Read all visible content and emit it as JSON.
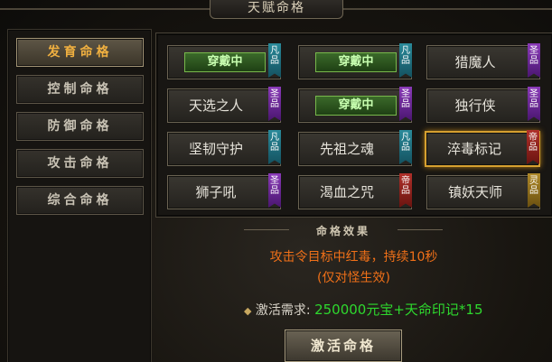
{
  "window": {
    "title": "天赋命格"
  },
  "sidebar": {
    "items": [
      {
        "label": "发育命格",
        "active": true
      },
      {
        "label": "控制命格",
        "active": false
      },
      {
        "label": "防御命格",
        "active": false
      },
      {
        "label": "攻击命格",
        "active": false
      },
      {
        "label": "综合命格",
        "active": false
      }
    ]
  },
  "grid": {
    "cards": [
      {
        "name": "",
        "equipped_label": "穿戴中",
        "equipped": true,
        "grade": "凡品",
        "selected": false
      },
      {
        "name": "",
        "equipped_label": "穿戴中",
        "equipped": true,
        "grade": "凡品",
        "selected": false
      },
      {
        "name": "猎魔人",
        "equipped_label": "",
        "equipped": false,
        "grade": "圣品",
        "selected": false
      },
      {
        "name": "天选之人",
        "equipped_label": "",
        "equipped": false,
        "grade": "圣品",
        "selected": false
      },
      {
        "name": "",
        "equipped_label": "穿戴中",
        "equipped": true,
        "grade": "圣品",
        "selected": false
      },
      {
        "name": "独行侠",
        "equipped_label": "",
        "equipped": false,
        "grade": "圣品",
        "selected": false
      },
      {
        "name": "坚韧守护",
        "equipped_label": "",
        "equipped": false,
        "grade": "凡品",
        "selected": false
      },
      {
        "name": "先祖之魂",
        "equipped_label": "",
        "equipped": false,
        "grade": "凡品",
        "selected": false
      },
      {
        "name": "淬毒标记",
        "equipped_label": "",
        "equipped": false,
        "grade": "帝品",
        "selected": true
      },
      {
        "name": "狮子吼",
        "equipped_label": "",
        "equipped": false,
        "grade": "圣品",
        "selected": false
      },
      {
        "name": "渴血之咒",
        "equipped_label": "",
        "equipped": false,
        "grade": "帝品",
        "selected": false
      },
      {
        "name": "镇妖天师",
        "equipped_label": "",
        "equipped": false,
        "grade": "灵品",
        "selected": false
      }
    ]
  },
  "effect": {
    "header": "命格效果",
    "line1": "攻击令目标中红毒，持续10秒",
    "line2": "(仅对怪生效)"
  },
  "requirement": {
    "label": "激活需求:",
    "value": "250000元宝+天命印记*15"
  },
  "actions": {
    "activate_label": "激活命格"
  },
  "colors": {
    "grade_fan": "#2a8a9a",
    "grade_sheng": "#8a3ab8",
    "grade_di": "#b0302a",
    "grade_ling": "#b08a2a",
    "effect_text": "#f07018",
    "requirement_value": "#2ed82e",
    "active_tab_text": "#f0b040"
  }
}
